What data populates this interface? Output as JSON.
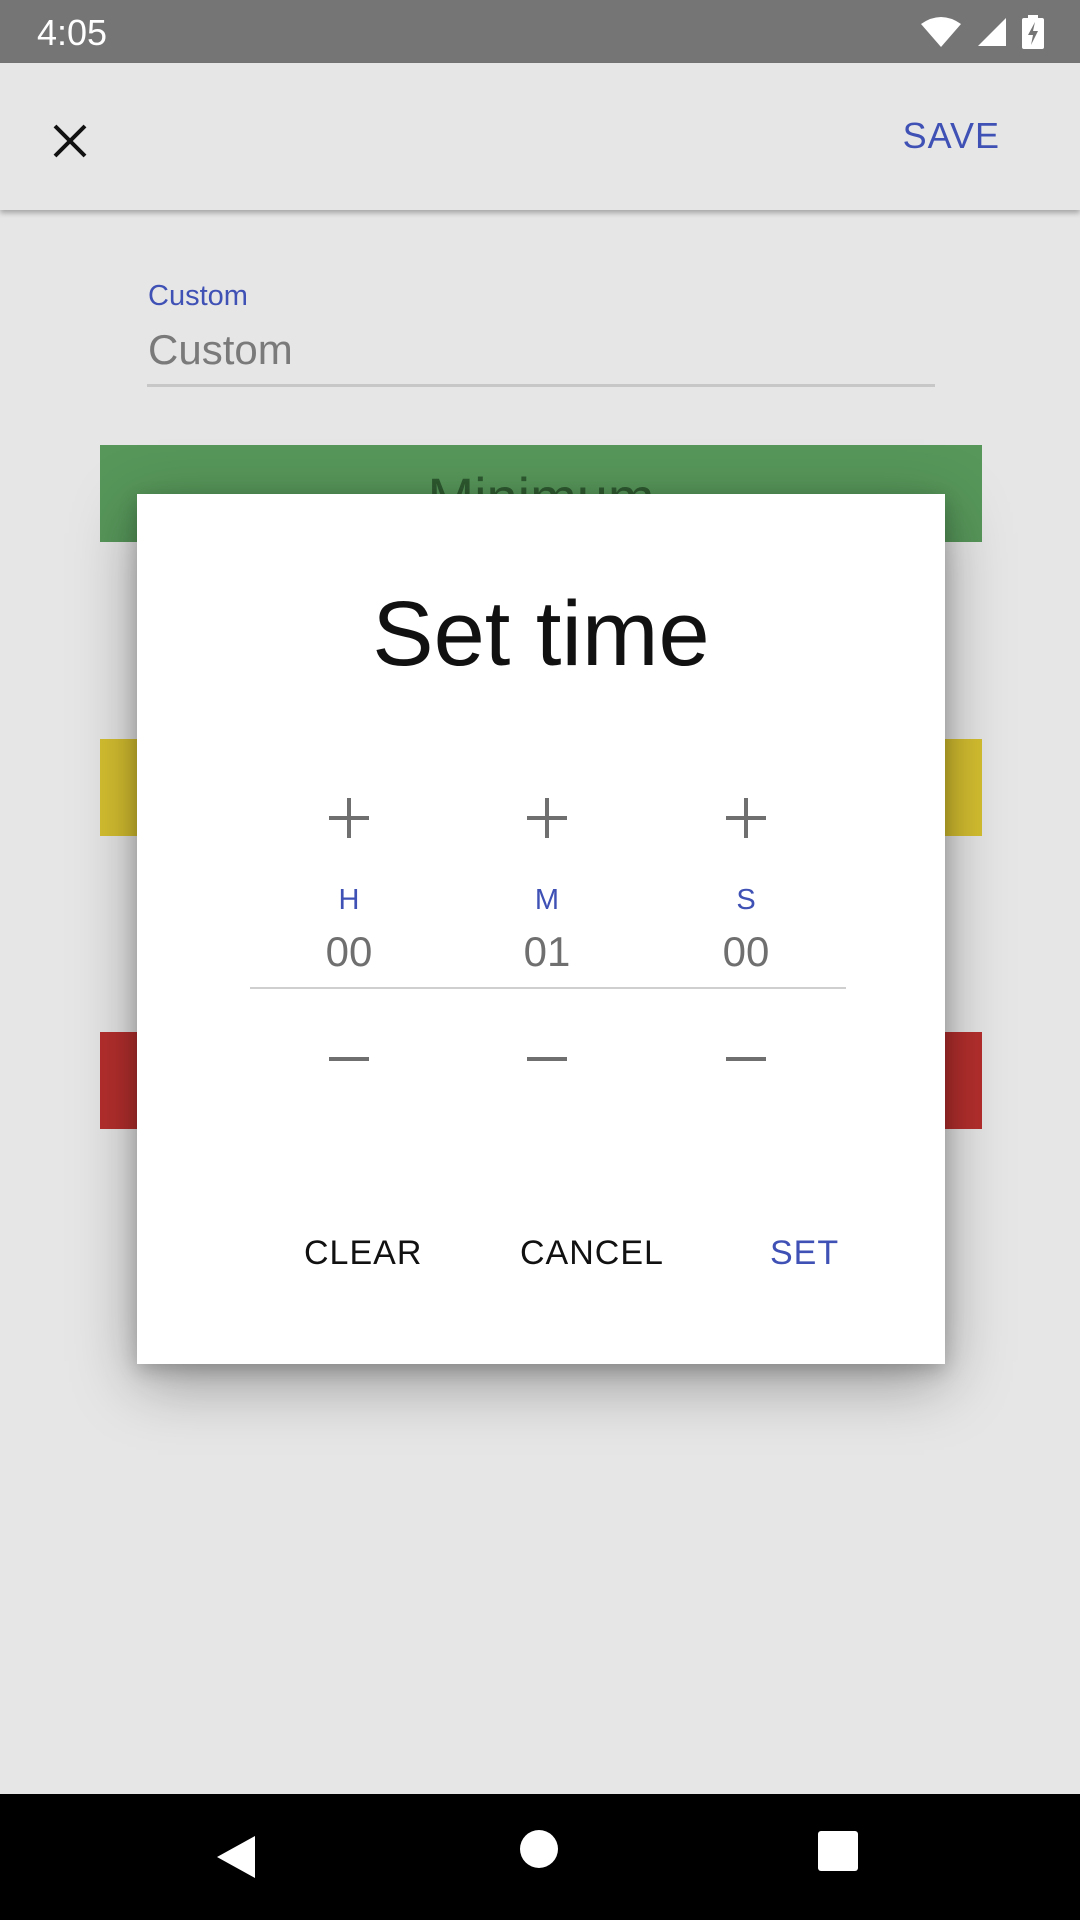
{
  "status_bar": {
    "time": "4:05"
  },
  "app_bar": {
    "save_label": "SAVE"
  },
  "field": {
    "label": "Custom",
    "value": "Custom"
  },
  "bands": {
    "green_text": "Minimum"
  },
  "dialog": {
    "title": "Set time",
    "units": [
      {
        "label": "H",
        "value": "00"
      },
      {
        "label": "M",
        "value": "01"
      },
      {
        "label": "S",
        "value": "00"
      }
    ],
    "buttons": {
      "clear": "CLEAR",
      "cancel": "CANCEL",
      "set": "SET"
    }
  },
  "colors": {
    "accent": "#3f51b5",
    "green": "#57975a",
    "yellow": "#d6c030",
    "red": "#b52f2d"
  }
}
